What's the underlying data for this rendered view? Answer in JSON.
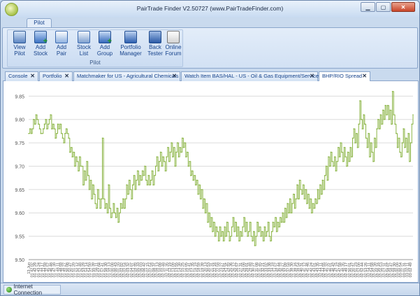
{
  "window": {
    "title": "PairTrade Finder V2.50727 (www.PairTradeFinder.com)"
  },
  "ribbon": {
    "tab": "Pilot",
    "group_label": "Pilot",
    "buttons": [
      {
        "line1": "View",
        "line2": "Pilot",
        "icon": "view-pilot-icon"
      },
      {
        "line1": "Add",
        "line2": "Stock",
        "icon": "add-stock-icon"
      },
      {
        "line1": "Add",
        "line2": "Pair",
        "icon": "add-pair-icon"
      },
      {
        "line1": "Stock",
        "line2": "List",
        "icon": "stock-list-icon"
      },
      {
        "line1": "Add",
        "line2": "Group",
        "icon": "add-group-icon"
      },
      {
        "line1": "Portfolio",
        "line2": "Manager",
        "icon": "portfolio-manager-icon"
      },
      {
        "line1": "Back",
        "line2": "Tester",
        "icon": "back-tester-icon"
      },
      {
        "line1": "Online",
        "line2": "Forum",
        "icon": "online-forum-icon"
      }
    ]
  },
  "tabs": [
    {
      "label": "Console"
    },
    {
      "label": "Portfolio"
    },
    {
      "label": "Matchmaker for US - Agricultural Chemicals"
    },
    {
      "label": "Watch Item BAS/HAL - US - Oil & Gas Equipment/Services"
    },
    {
      "label": "BHP/RIO Spread"
    }
  ],
  "status": {
    "label": "Internet Connection"
  },
  "colors": {
    "line": "#8bb545",
    "grid": "#dcdcdc"
  },
  "chart_data": {
    "type": "line",
    "ylim": [
      9.5,
      9.87
    ],
    "yticks": [
      "9.85",
      "9.80",
      "9.75",
      "9.70",
      "9.65",
      "9.60",
      "9.55",
      "9.50"
    ],
    "ytick_values": [
      9.85,
      9.8,
      9.75,
      9.7,
      9.65,
      9.6,
      9.55,
      9.5
    ],
    "xlabels": [
      "13 Jun",
      "01 42 02",
      "01 42 29",
      "01 43 24",
      "01 44 17",
      "01 44 59",
      "01 45 57",
      "01 46 48",
      "01 47 39",
      "01 48 11",
      "01 48 59",
      "01 49 27",
      "01 50 08",
      "01 50 47",
      "01 51 20",
      "01 52 12",
      "01 52 48",
      "01 53 29",
      "01 54 14",
      "01 54 50",
      "01 55 39",
      "01 56 11",
      "01 57 04",
      "01 57 41",
      "01 58 30",
      "01 59 13",
      "02 00 08",
      "02 00 43",
      "02 01 20",
      "02 02 02",
      "02 02 54",
      "02 03 32",
      "02 04 07",
      "02 04 46",
      "02 05 33",
      "02 06 03",
      "02 06 42",
      "02 07 15",
      "02 07 54",
      "02 08 37",
      "02 09 13",
      "02 10 09",
      "02 10 48",
      "02 11 35",
      "02 12 19",
      "02 13 09",
      "02 13 55",
      "02 14 39",
      "02 15 25",
      "02 16 05",
      "02 16 41",
      "02 17 35",
      "02 18 19",
      "02 18 59",
      "02 19 39",
      "02 20 13",
      "02 20 53",
      "02 21 31",
      "02 22 16",
      "02 22 58",
      "02 23 27",
      "02 24 01",
      "02 24 45",
      "02 25 36",
      "02 26 12",
      "02 26 57",
      "02 27 31",
      "02 28 08",
      "02 29 01",
      "02 29 48",
      "02 30 27",
      "02 31 08",
      "02 31 45",
      "02 32 21",
      "02 33 02",
      "02 33 38",
      "02 34 18",
      "02 34 57",
      "02 35 44",
      "02 36 27",
      "02 37 09",
      "02 37 58",
      "02 38 30",
      "02 39 16",
      "02 39 54",
      "02 40 31",
      "02 41 12",
      "02 41 46",
      "02 42 24",
      "02 43 01",
      "02 43 35",
      "02 44 11",
      "02 44 55",
      "02 45 32",
      "02 46 01",
      "02 46 42",
      "02 47 19",
      "02 47 58",
      "02 48 35",
      "02 49 17",
      "02 50 01",
      "02 50 47",
      "02 51 23",
      "02 52 09",
      "02 52 44",
      "02 53 26",
      "02 54 11",
      "02 54 58",
      "02 55 39",
      "02 56 16",
      "02 56 53",
      "02 57 31",
      "02 58 07",
      "02 58 47",
      "02 59 30",
      "03 00 09",
      "03 00 54",
      "03 01 31",
      "03 02 11",
      "03 02 49"
    ],
    "series": [
      {
        "values": [
          9.77,
          9.78,
          9.77,
          9.78,
          9.8,
          9.79,
          9.81,
          9.8,
          9.79,
          9.78,
          9.77,
          9.77,
          9.78,
          9.79,
          9.8,
          9.78,
          9.79,
          9.8,
          9.81,
          9.78,
          9.79,
          9.78,
          9.76,
          9.77,
          9.79,
          9.78,
          9.79,
          9.77,
          9.76,
          9.75,
          9.77,
          9.78,
          9.77,
          9.76,
          9.73,
          9.74,
          9.72,
          9.73,
          9.7,
          9.72,
          9.71,
          9.69,
          9.72,
          9.7,
          9.7,
          9.66,
          9.69,
          9.67,
          9.71,
          9.68,
          9.65,
          9.67,
          9.63,
          9.66,
          9.64,
          9.62,
          9.61,
          9.65,
          9.63,
          9.61,
          9.63,
          9.76,
          9.63,
          9.61,
          9.62,
          9.6,
          9.66,
          9.61,
          9.59,
          9.6,
          9.62,
          9.6,
          9.59,
          9.61,
          9.58,
          9.6,
          9.62,
          9.61,
          9.63,
          9.61,
          9.63,
          9.66,
          9.64,
          9.67,
          9.65,
          9.63,
          9.66,
          9.68,
          9.65,
          9.67,
          9.69,
          9.66,
          9.68,
          9.67,
          9.69,
          9.68,
          9.7,
          9.67,
          9.66,
          9.68,
          9.66,
          9.67,
          9.69,
          9.66,
          9.68,
          9.7,
          9.72,
          9.69,
          9.71,
          9.73,
          9.7,
          9.72,
          9.71,
          9.69,
          9.72,
          9.74,
          9.71,
          9.73,
          9.75,
          9.72,
          9.74,
          9.7,
          9.73,
          9.75,
          9.72,
          9.74,
          9.73,
          9.76,
          9.74,
          9.75,
          9.72,
          9.73,
          9.7,
          9.71,
          9.68,
          9.69,
          9.67,
          9.68,
          9.66,
          9.67,
          9.64,
          9.66,
          9.63,
          9.65,
          9.61,
          9.63,
          9.6,
          9.62,
          9.58,
          9.6,
          9.57,
          9.59,
          9.56,
          9.58,
          9.55,
          9.57,
          9.56,
          9.54,
          9.57,
          9.55,
          9.56,
          9.54,
          9.57,
          9.55,
          9.58,
          9.56,
          9.54,
          9.55,
          9.57,
          9.59,
          9.56,
          9.58,
          9.55,
          9.57,
          9.54,
          9.56,
          9.55,
          9.57,
          9.59,
          9.56,
          9.58,
          9.55,
          9.56,
          9.58,
          9.55,
          9.54,
          9.56,
          9.53,
          9.55,
          9.58,
          9.56,
          9.57,
          9.55,
          9.56,
          9.54,
          9.57,
          9.55,
          9.56,
          9.58,
          9.55,
          9.54,
          9.56,
          9.58,
          9.57,
          9.59,
          9.56,
          9.58,
          9.57,
          9.59,
          9.58,
          9.6,
          9.58,
          9.61,
          9.59,
          9.62,
          9.6,
          9.63,
          9.6,
          9.62,
          9.64,
          9.61,
          9.63,
          9.66,
          9.63,
          9.67,
          9.65,
          9.64,
          9.66,
          9.63,
          9.65,
          9.62,
          9.64,
          9.61,
          9.63,
          9.6,
          9.62,
          9.61,
          9.63,
          9.62,
          9.65,
          9.63,
          9.66,
          9.64,
          9.67,
          9.65,
          9.68,
          9.7,
          9.67,
          9.72,
          9.7,
          9.73,
          9.71,
          9.7,
          9.72,
          9.69,
          9.71,
          9.74,
          9.72,
          9.75,
          9.73,
          9.71,
          9.74,
          9.72,
          9.7,
          9.73,
          9.71,
          9.74,
          9.72,
          9.76,
          9.78,
          9.75,
          9.77,
          9.74,
          9.79,
          9.84,
          9.8,
          9.78,
          9.81,
          9.79,
          9.76,
          9.74,
          9.77,
          9.72,
          9.75,
          9.73,
          9.71,
          9.76,
          9.74,
          9.78,
          9.8,
          9.78,
          9.81,
          9.79,
          9.82,
          9.8,
          9.83,
          9.81,
          9.83,
          9.8,
          9.82,
          9.79,
          9.86,
          9.81,
          9.79,
          9.77,
          9.74,
          9.76,
          9.73,
          9.72,
          9.75,
          9.78,
          9.74,
          9.76,
          9.73,
          9.77,
          9.71,
          9.75,
          9.79,
          9.81
        ]
      }
    ]
  }
}
